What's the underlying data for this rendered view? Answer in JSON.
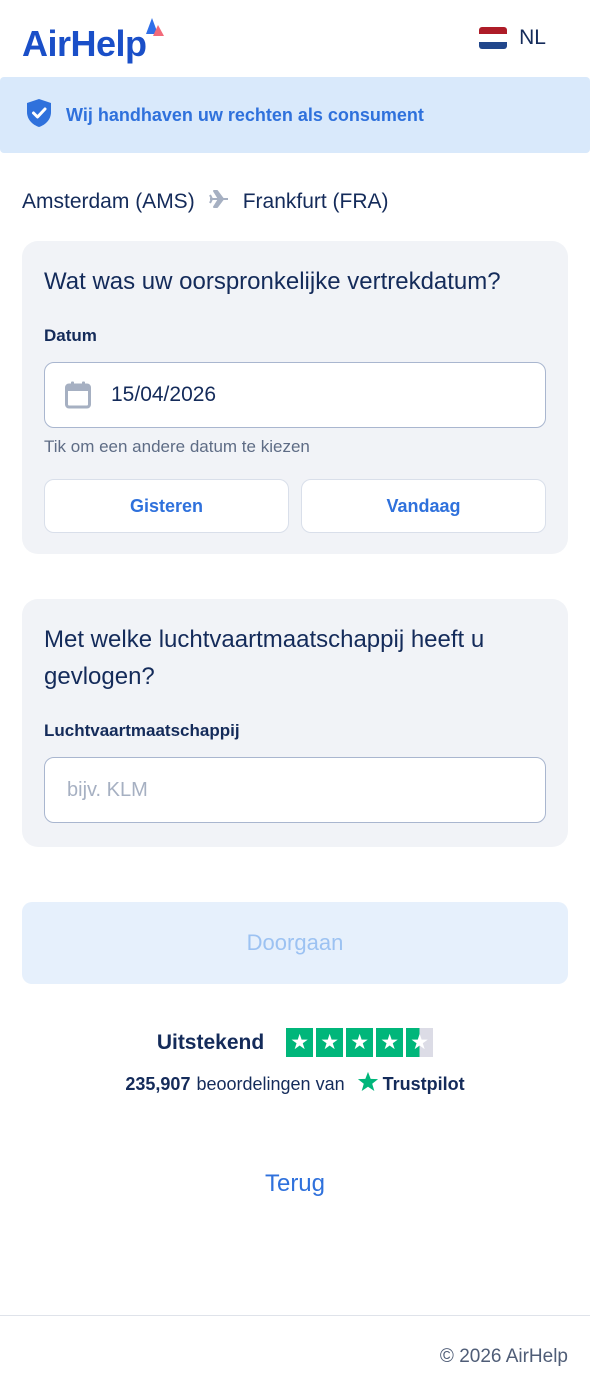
{
  "header": {
    "logo_text": "AirHelp",
    "language": "NL",
    "flag_colors": [
      "#ae1c28",
      "#ffffff",
      "#21468b"
    ]
  },
  "banner": {
    "icon": "shield-check-icon",
    "text": "Wij handhaven uw rechten als consument"
  },
  "route": {
    "origin": "Amsterdam (AMS)",
    "destination": "Frankfurt (FRA)",
    "icon": "airplane-icon"
  },
  "date_card": {
    "title": "Wat was uw oorspronkelijke vertrekdatum?",
    "field_label": "Datum",
    "date_value": "15/04/2026",
    "hint": "Tik om een andere datum te kiezen",
    "yesterday_label": "Gisteren",
    "today_label": "Vandaag"
  },
  "airline_card": {
    "title": "Met welke luchtvaartmaatschappij heeft u gevlogen?",
    "field_label": "Luchtvaartmaatschappij",
    "placeholder": "bijv. KLM",
    "value": ""
  },
  "continue_label": "Doorgaan",
  "trustpilot": {
    "rating_label": "Uitstekend",
    "stars": 4.5,
    "review_count": "235,907",
    "reviews_text": "beoordelingen van",
    "brand": "Trustpilot",
    "brand_color": "#00b67a"
  },
  "back_label": "Terug",
  "footer": {
    "copyright": "© 2026 AirHelp"
  },
  "colors": {
    "brand_blue": "#1a4fc8",
    "accent_blue": "#2f71dc",
    "navy_text": "#142b5a",
    "banner_bg": "#d9e9fb",
    "card_bg": "#f1f3f7"
  }
}
